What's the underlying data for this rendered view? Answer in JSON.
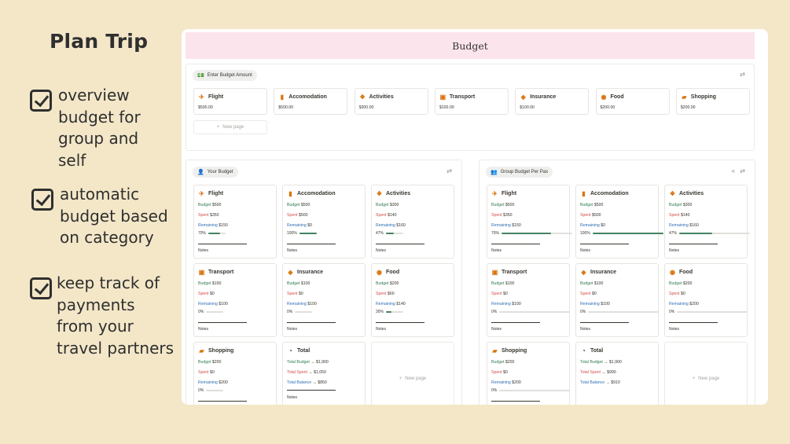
{
  "promo": {
    "title": "Plan Trip",
    "features": [
      [
        "overview",
        "budget for",
        "group and",
        "self"
      ],
      [
        "automatic",
        "budget based",
        "on category"
      ],
      [
        "keep track of",
        "payments",
        "from your",
        "travel partners"
      ]
    ]
  },
  "window": {
    "title": "Budget",
    "enter_panel": {
      "tag": "Enter Budget Amount",
      "cards": [
        {
          "label": "Flight",
          "icon": "plane-icon",
          "glyph": "✈",
          "amount": "$500.00"
        },
        {
          "label": "Accomodation",
          "icon": "hotel-icon",
          "glyph": "▮",
          "amount": "$500.00"
        },
        {
          "label": "Activities",
          "icon": "elephant-icon",
          "glyph": "❖",
          "amount": "$300.00"
        },
        {
          "label": "Transport",
          "icon": "train-icon",
          "glyph": "▣",
          "amount": "$100.00"
        },
        {
          "label": "Insurance",
          "icon": "shield-icon",
          "glyph": "◈",
          "amount": "$100.00"
        },
        {
          "label": "Food",
          "icon": "food-icon",
          "glyph": "◉",
          "amount": "$200.00"
        },
        {
          "label": "Shopping",
          "icon": "bag-icon",
          "glyph": "▰",
          "amount": "$200.00"
        }
      ],
      "new_page": "New page"
    },
    "your_budget": {
      "tag": "Your Budget",
      "cards": [
        {
          "label": "Flight",
          "icon": "plane-icon",
          "glyph": "✈",
          "budget": "$500",
          "spent": "$350",
          "remaining": "$150",
          "pct": "70%",
          "progress": 0.7
        },
        {
          "label": "Accomodation",
          "icon": "hotel-icon",
          "glyph": "▮",
          "budget": "$500",
          "spent": "$500",
          "remaining": "$0",
          "pct": "100%",
          "progress": 1.0
        },
        {
          "label": "Activities",
          "icon": "elephant-icon",
          "glyph": "❖",
          "budget": "$300",
          "spent": "$140",
          "remaining": "$160",
          "pct": "47%",
          "progress": 0.47
        },
        {
          "label": "Transport",
          "icon": "train-icon",
          "glyph": "▣",
          "budget": "$100",
          "spent": "$0",
          "remaining": "$100",
          "pct": "0%",
          "progress": 0
        },
        {
          "label": "Insurance",
          "icon": "shield-icon",
          "glyph": "◈",
          "budget": "$100",
          "spent": "$0",
          "remaining": "$100",
          "pct": "0%",
          "progress": 0
        },
        {
          "label": "Food",
          "icon": "food-icon",
          "glyph": "◉",
          "budget": "$200",
          "spent": "$60",
          "remaining": "$140",
          "pct": "30%",
          "progress": 0.3
        },
        {
          "label": "Shopping",
          "icon": "bag-icon",
          "glyph": "▰",
          "budget": "$200",
          "spent": "$0",
          "remaining": "$200",
          "pct": "0%",
          "progress": 0
        }
      ],
      "total": {
        "label": "Total",
        "total_budget": "$1,900",
        "total_spent": "$1,050",
        "total_balance": "$850"
      },
      "new_page": "New page"
    },
    "group_budget": {
      "tag": "Group Budget Per Pax",
      "cards": [
        {
          "label": "Flight",
          "icon": "plane-icon",
          "glyph": "✈",
          "budget": "$500",
          "spent": "$350",
          "remaining": "$150",
          "pct": "70%",
          "progress": 0.7
        },
        {
          "label": "Accomodation",
          "icon": "hotel-icon",
          "glyph": "▮",
          "budget": "$500",
          "spent": "$500",
          "remaining": "$0",
          "pct": "100%",
          "progress": 1.0
        },
        {
          "label": "Activities",
          "icon": "elephant-icon",
          "glyph": "❖",
          "budget": "$300",
          "spent": "$140",
          "remaining": "$160",
          "pct": "47%",
          "progress": 0.47
        },
        {
          "label": "Transport",
          "icon": "train-icon",
          "glyph": "▣",
          "budget": "$100",
          "spent": "$0",
          "remaining": "$100",
          "pct": "0%",
          "progress": 0
        },
        {
          "label": "Insurance",
          "icon": "shield-icon",
          "glyph": "◈",
          "budget": "$100",
          "spent": "$0",
          "remaining": "$100",
          "pct": "0%",
          "progress": 0
        },
        {
          "label": "Food",
          "icon": "food-icon",
          "glyph": "◉",
          "budget": "$200",
          "spent": "$0",
          "remaining": "$200",
          "pct": "0%",
          "progress": 0
        },
        {
          "label": "Shopping",
          "icon": "bag-icon",
          "glyph": "▰",
          "budget": "$200",
          "spent": "$0",
          "remaining": "$200",
          "pct": "0%",
          "progress": 0
        }
      ],
      "total": {
        "label": "Total",
        "total_budget": "$1,900",
        "total_spent": "$990",
        "total_balance": "$910"
      },
      "new_page": "New page"
    },
    "labels": {
      "budget": "Budget",
      "spent": "Spent",
      "remaining": "Remaining",
      "notes": "Notes",
      "total_budget": "Total Budget",
      "total_spent": "Total Spent",
      "total_balance": "Total Balance",
      "arrow": "→"
    },
    "colors": {
      "banner": "#fbe4ec",
      "budget": "#2e7d4f",
      "spent": "#d44c47",
      "remaining": "#2f6fb5",
      "progress": "#448361",
      "icon": "#d9730d"
    }
  }
}
